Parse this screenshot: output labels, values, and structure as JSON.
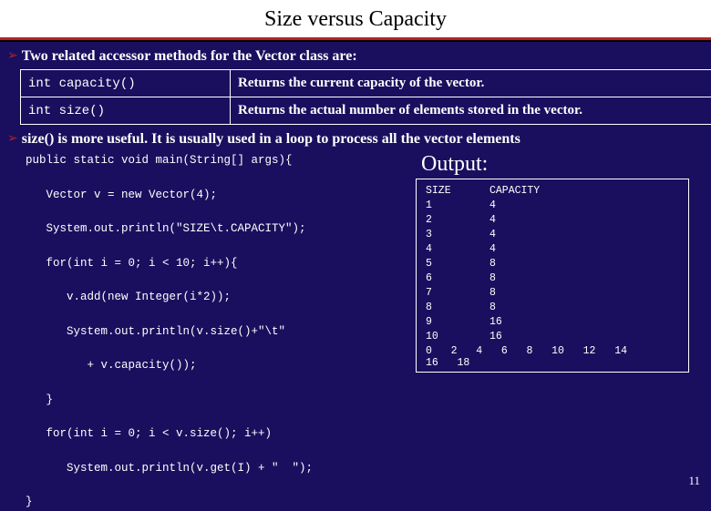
{
  "title": "Size versus Capacity",
  "bullets": {
    "b1": "Two related accessor methods for the Vector class are:",
    "b2": "size() is more useful. It is usually used in a loop to process all the vector elements"
  },
  "methods": [
    {
      "sig": "int capacity()",
      "desc": "Returns the current capacity of the vector."
    },
    {
      "sig": "int size()",
      "desc": "Returns the actual number of elements stored in the vector."
    }
  ],
  "code": "public static void main(String[] args){\n\n   Vector v = new Vector(4);\n\n   System.out.println(\"SIZE\\t.CAPACITY\");\n\n   for(int i = 0; i < 10; i++){\n\n      v.add(new Integer(i*2));\n\n      System.out.println(v.size()+\"\\t\"\n\n         + v.capacity());\n\n   }\n\n   for(int i = 0; i < v.size(); i++)\n\n      System.out.println(v.get(I) + \"  \");\n\n}",
  "output": {
    "label": "Output:",
    "header": {
      "c1": "SIZE",
      "c2": "CAPACITY"
    },
    "rows": [
      {
        "c1": "1",
        "c2": "4"
      },
      {
        "c1": "2",
        "c2": "4"
      },
      {
        "c1": "3",
        "c2": "4"
      },
      {
        "c1": "4",
        "c2": "4"
      },
      {
        "c1": "5",
        "c2": "8"
      },
      {
        "c1": "6",
        "c2": "8"
      },
      {
        "c1": "7",
        "c2": "8"
      },
      {
        "c1": "8",
        "c2": "8"
      },
      {
        "c1": "9",
        "c2": "16"
      },
      {
        "c1": "10",
        "c2": "16"
      }
    ],
    "last": [
      "0",
      "2",
      "4",
      "6",
      "8",
      "10",
      "12",
      "14",
      "16",
      "18"
    ]
  },
  "page": "11"
}
